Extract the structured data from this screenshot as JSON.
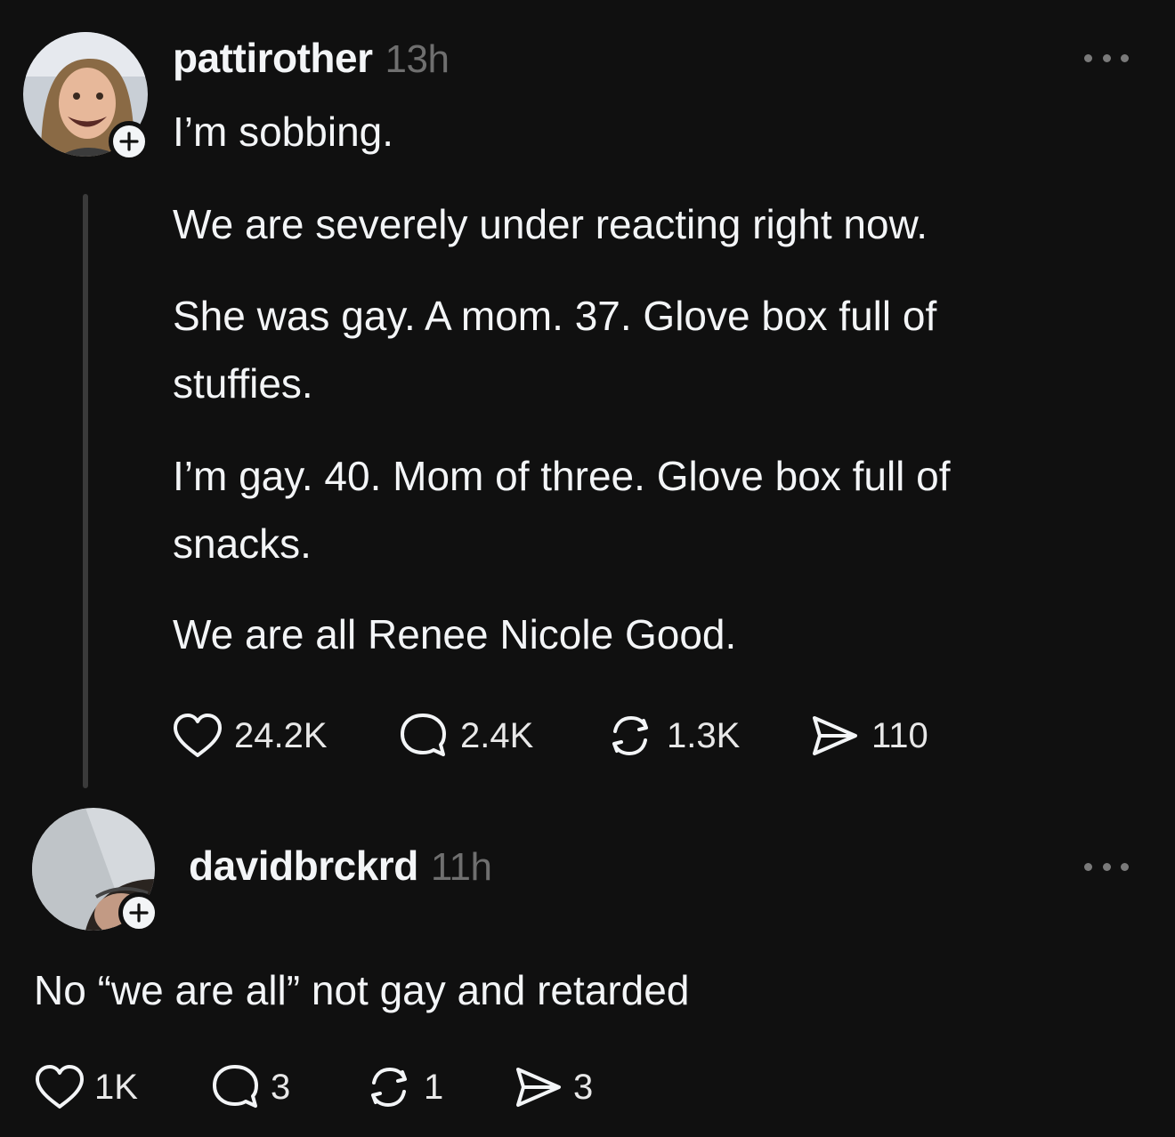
{
  "post": {
    "username": "pattirother",
    "time": "13h",
    "first_line": "I’m sobbing.",
    "paragraphs": [
      "We are severely under reacting right now.",
      "She was gay. A mom. 37. Glove box full of stuffies.",
      "I’m gay. 40. Mom of three. Glove box full of snacks.",
      "We are all Renee Nicole Good."
    ],
    "likes": "24.2K",
    "replies": "2.4K",
    "reposts": "1.3K",
    "shares": "110"
  },
  "reply": {
    "username": "davidbrckrd",
    "time": "11h",
    "text": "No “we are all” not gay and retarded",
    "likes": "1K",
    "replies": "3",
    "reposts": "1",
    "shares": "3"
  },
  "icons": {
    "like": "heart-icon",
    "reply": "speech-bubble-icon",
    "repost": "repost-icon",
    "share": "send-icon",
    "more": "more-dots-icon",
    "follow": "plus-icon"
  },
  "colors": {
    "background": "#101010",
    "text": "#f3f5f7",
    "muted": "#6f6f6f",
    "thread_line": "#3a3a3a"
  }
}
